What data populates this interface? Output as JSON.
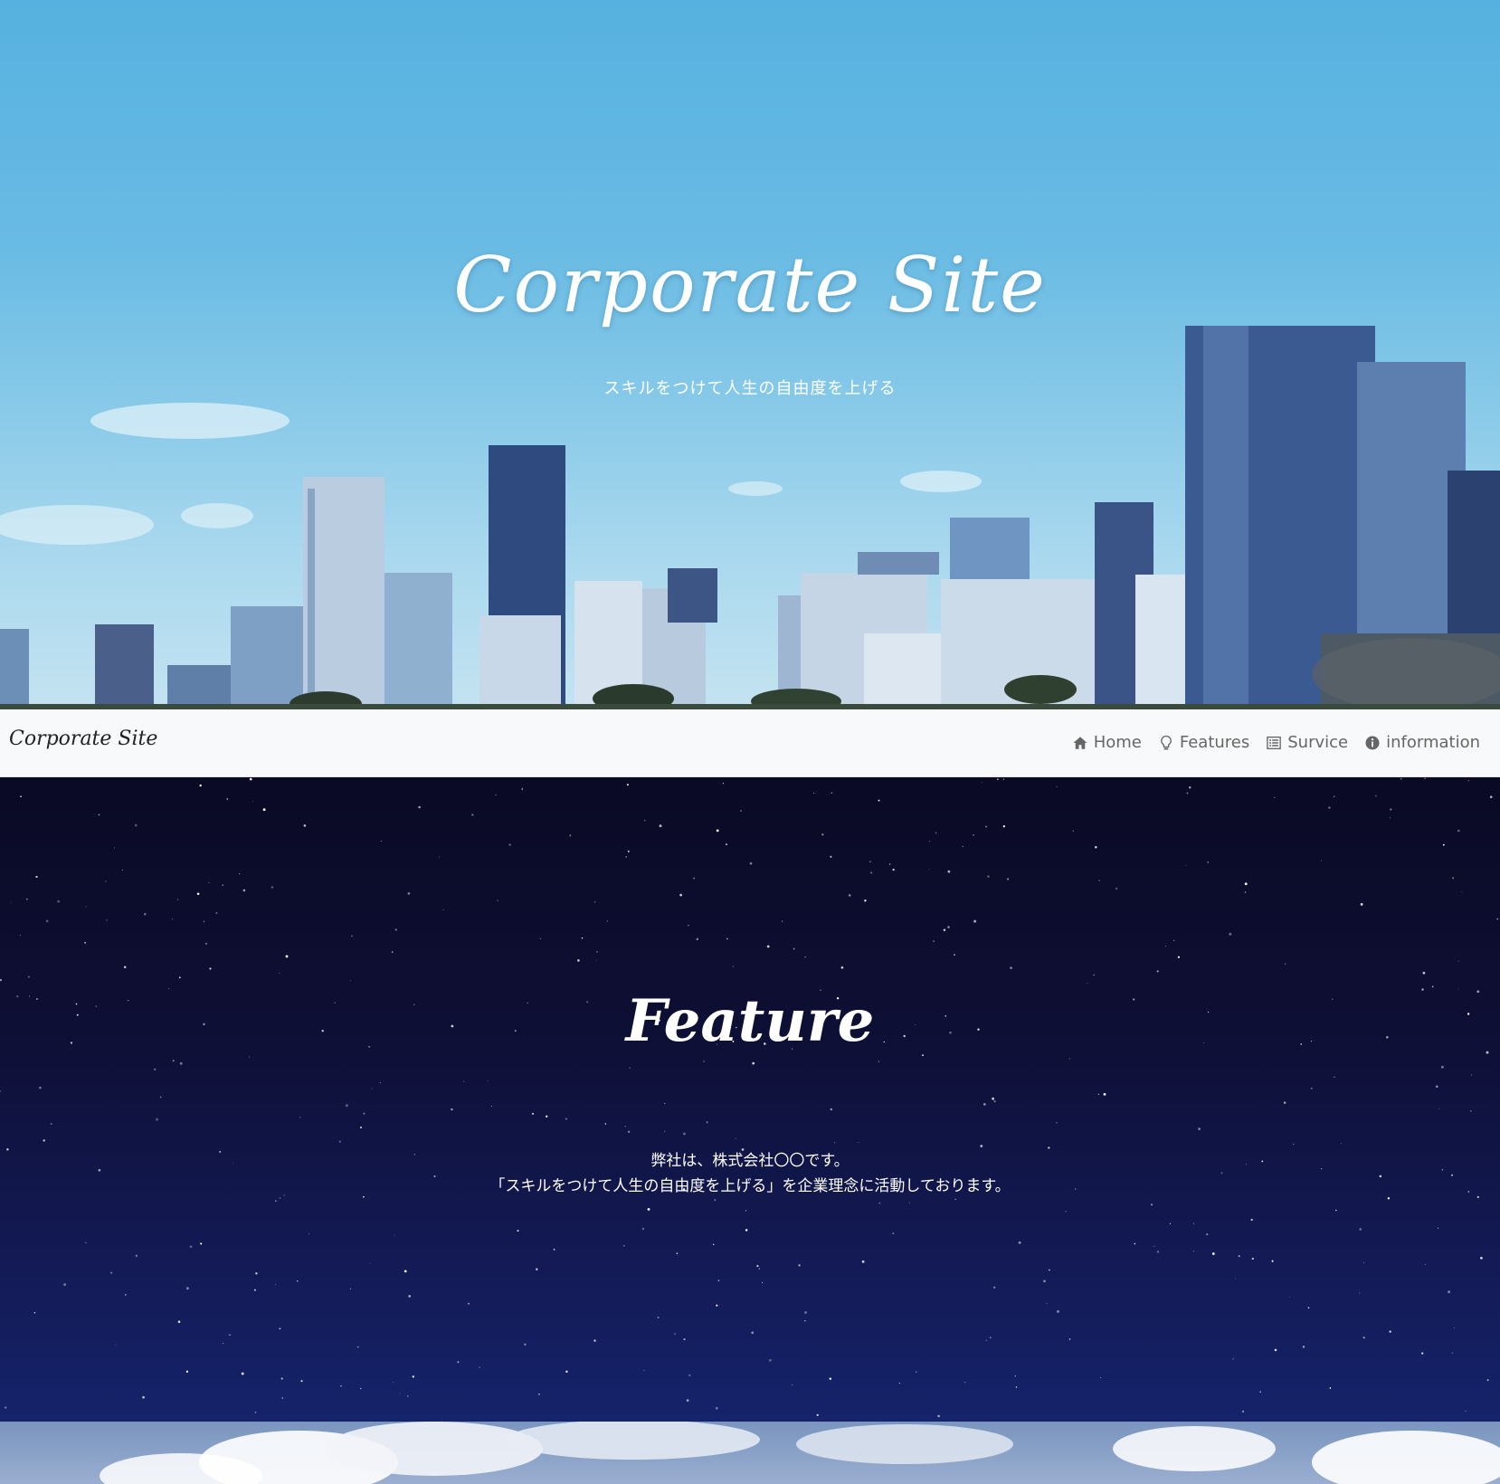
{
  "hero": {
    "title": "Corporate Site",
    "subtitle": "スキルをつけて人生の自由度を上げる"
  },
  "navbar": {
    "brand": "Corporate Site",
    "items": [
      {
        "label": "Home",
        "icon": "home-icon"
      },
      {
        "label": "Features",
        "icon": "lightbulb-icon"
      },
      {
        "label": "Survice",
        "icon": "list-icon"
      },
      {
        "label": "information",
        "icon": "info-icon"
      }
    ]
  },
  "feature": {
    "title": "Feature",
    "line1": "弊社は、株式会社〇〇です。",
    "line2": "「スキルをつけて人生の自由度を上げる」を企業理念に活動しております。"
  },
  "colors": {
    "sky": "#69bbe4",
    "night": "#0e0f35",
    "navbar_bg": "#f8f9fa",
    "nav_text": "#666666"
  }
}
